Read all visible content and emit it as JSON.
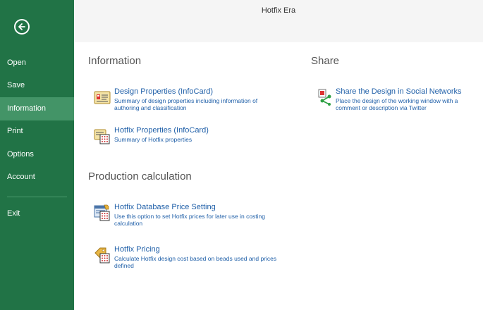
{
  "window": {
    "title": "Hotfix Era"
  },
  "sidebar": {
    "items": [
      {
        "label": "Open"
      },
      {
        "label": "Save"
      },
      {
        "label": "Information"
      },
      {
        "label": "Print"
      },
      {
        "label": "Options"
      },
      {
        "label": "Account"
      },
      {
        "label": "Exit"
      }
    ],
    "active": "Information",
    "colors": {
      "background": "#217346",
      "active": "#439467"
    }
  },
  "information": {
    "heading": "Information",
    "items": [
      {
        "title": "Design Properties (InfoCard)",
        "desc": "Summary of design properties including information of authoring and classification",
        "icon": "design-properties-icon"
      },
      {
        "title": "Hotfix Properties (InfoCard)",
        "desc": "Summary of Hotfix properties",
        "icon": "hotfix-properties-icon"
      }
    ]
  },
  "production": {
    "heading": "Production calculation",
    "items": [
      {
        "title": "Hotfix Database Price Setting",
        "desc": "Use this option to set Hotfix prices for later use in costing calculation",
        "icon": "price-setting-icon"
      },
      {
        "title": "Hotfix Pricing",
        "desc": "Calculate Hotfix design cost based on beads used and prices defined",
        "icon": "price-tag-icon"
      }
    ]
  },
  "share": {
    "heading": "Share",
    "items": [
      {
        "title": "Share the Design in Social Networks",
        "desc": "Place the design of the working window with a comment or description via Twitter",
        "icon": "share-icon"
      }
    ]
  },
  "colors": {
    "link": "#1f5fa8",
    "heading": "#555555"
  }
}
